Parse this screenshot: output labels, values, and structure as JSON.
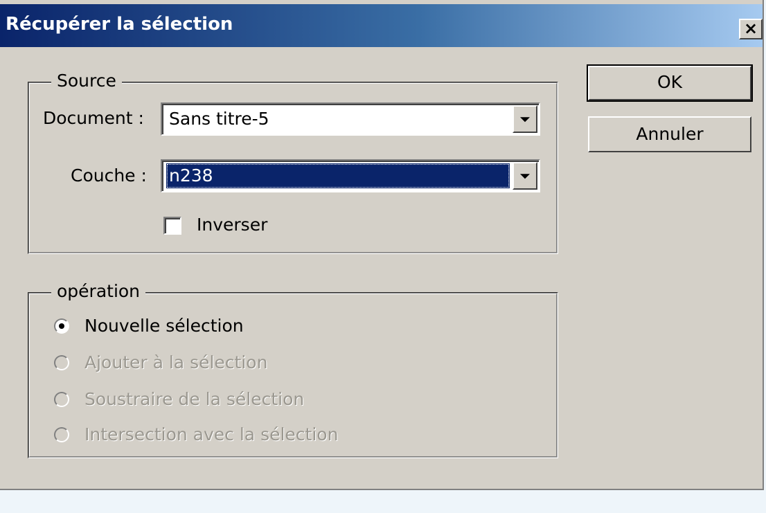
{
  "window": {
    "title": "Récupérer la sélection",
    "close_glyph": "×",
    "close_icon": "close-icon"
  },
  "buttons": {
    "ok_label": "OK",
    "cancel_label": "Annuler"
  },
  "source": {
    "legend": "Source",
    "document_label": "Document :",
    "document_value": "Sans titre-5",
    "channel_label": "Couche :",
    "channel_value": "n238",
    "invert_label": "Inverser",
    "invert_checked": false
  },
  "operation": {
    "legend": "opération",
    "options": [
      {
        "label": "Nouvelle sélection",
        "selected": true,
        "enabled": true
      },
      {
        "label": "Ajouter à la sélection",
        "selected": false,
        "enabled": false
      },
      {
        "label": "Soustraire de la sélection",
        "selected": false,
        "enabled": false
      },
      {
        "label": "Intersection avec la sélection",
        "selected": false,
        "enabled": false
      }
    ]
  },
  "colors": {
    "title_gradient_start": "#0a246a",
    "title_gradient_end": "#a6caf0",
    "dialog_face": "#d4d0c8",
    "selection_highlight": "#0a246a",
    "disabled_text": "#9b9890"
  }
}
